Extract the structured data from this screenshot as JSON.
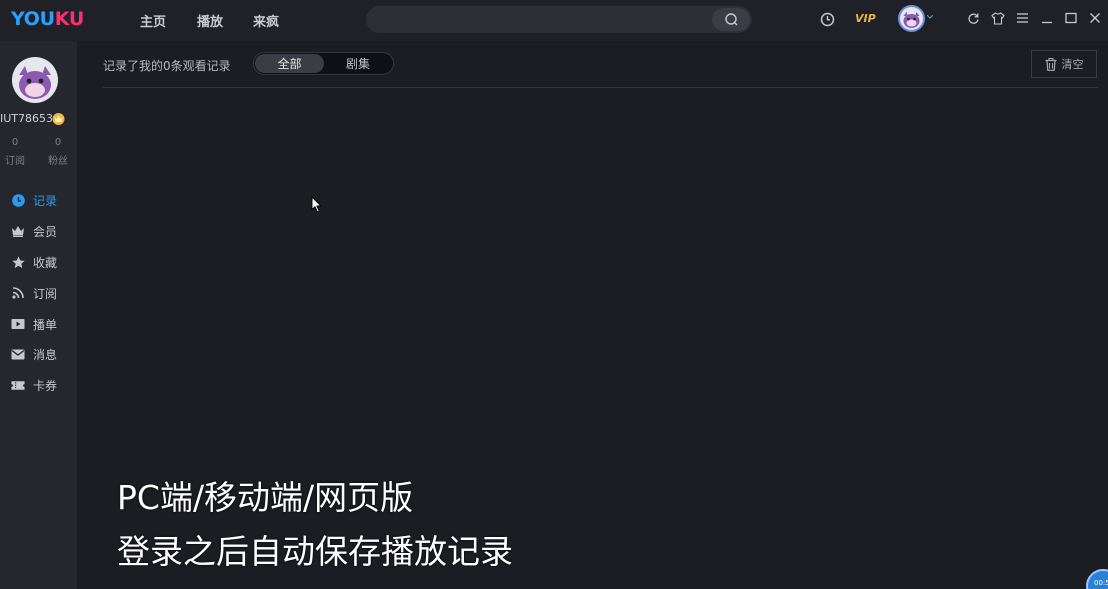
{
  "app": {
    "logo_left": "YOU",
    "logo_right": "KU"
  },
  "topnav": {
    "items": [
      "主页",
      "播放",
      "来疯"
    ],
    "vip_label": "VIP"
  },
  "search": {
    "placeholder": "",
    "value": ""
  },
  "window_controls": [
    "refresh-icon",
    "skin-icon",
    "menu-icon",
    "minimize-icon",
    "maximize-icon",
    "close-icon"
  ],
  "sidebar": {
    "username": "IUT78653",
    "stats": [
      {
        "count": "0",
        "label": "订阅"
      },
      {
        "count": "0",
        "label": "粉丝"
      }
    ],
    "items": [
      {
        "label": "记录",
        "icon": "clock-icon",
        "active": true
      },
      {
        "label": "会员",
        "icon": "crown-icon",
        "active": false
      },
      {
        "label": "收藏",
        "icon": "star-icon",
        "active": false
      },
      {
        "label": "订阅",
        "icon": "rss-icon",
        "active": false
      },
      {
        "label": "播单",
        "icon": "playlist-icon",
        "active": false
      },
      {
        "label": "消息",
        "icon": "mail-icon",
        "active": false
      },
      {
        "label": "卡券",
        "icon": "ticket-icon",
        "active": false
      }
    ]
  },
  "history": {
    "title": "记录了我的0条观看记录",
    "tabs": [
      {
        "label": "全部",
        "active": true
      },
      {
        "label": "剧集",
        "active": false
      }
    ],
    "clear_label": "清空"
  },
  "overlay": {
    "line1": "PC端/移动端/网页版",
    "line2": "登录之后自动保存播放记录"
  },
  "corner_badge": "00:5",
  "colors": {
    "accent": "#2d9bf0",
    "vip": "#e6b545",
    "logo_blue": "#2aa0ff",
    "logo_pink": "#ff2d6f"
  }
}
